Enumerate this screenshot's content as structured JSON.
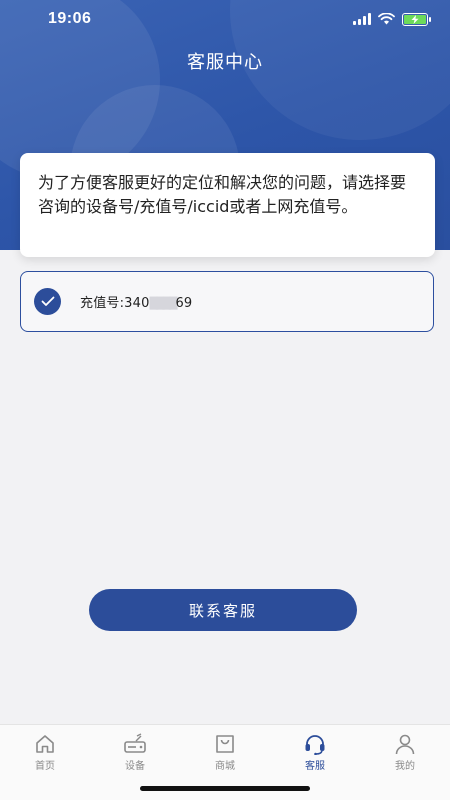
{
  "status_bar": {
    "time": "19:06"
  },
  "header": {
    "title": "客服中心"
  },
  "info": {
    "message": "为了方便客服更好的定位和解决您的问题，请选择要咨询的设备号/充值号/iccid或者上网充值号。"
  },
  "selection": {
    "label": "充值号:340",
    "masked": "████",
    "suffix": "69",
    "checked": true
  },
  "contact_button": {
    "label": "联系客服"
  },
  "tabbar": {
    "items": [
      {
        "label": "首页",
        "icon": "home-icon",
        "active": false
      },
      {
        "label": "设备",
        "icon": "router-icon",
        "active": false
      },
      {
        "label": "商城",
        "icon": "shopping-bag-icon",
        "active": false
      },
      {
        "label": "客服",
        "icon": "headset-icon",
        "active": true
      },
      {
        "label": "我的",
        "icon": "user-icon",
        "active": false
      }
    ]
  },
  "colors": {
    "primary": "#2c4d9a",
    "header_gradient_start": "#3a63b4",
    "battery_green": "#6ddb5b",
    "background": "#f2f2f4"
  }
}
